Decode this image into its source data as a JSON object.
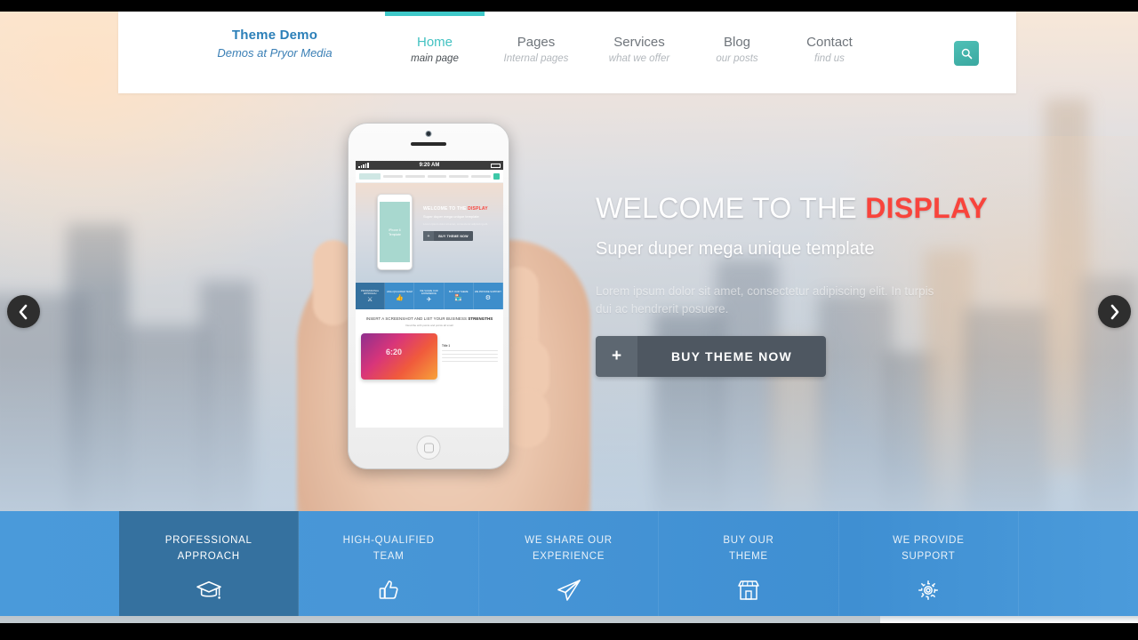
{
  "header": {
    "brand_title": "Theme Demo",
    "brand_subtitle": "Demos at Pryor Media",
    "search_icon": "search-icon",
    "nav": [
      {
        "label": "Home",
        "sub": "main page",
        "active": true
      },
      {
        "label": "Pages",
        "sub": "Internal pages",
        "active": false
      },
      {
        "label": "Services",
        "sub": "what we offer",
        "active": false
      },
      {
        "label": "Blog",
        "sub": "our posts",
        "active": false
      },
      {
        "label": "Contact",
        "sub": "find us",
        "active": false
      }
    ]
  },
  "hero": {
    "heading_main": "WELCOME TO THE ",
    "heading_accent": "DISPLAY",
    "subheading": "Super duper mega unique template",
    "paragraph": "Lorem ipsum dolor sit amet, consectetur adipiscing elit. In turpis dui ac hendrerit posuere.",
    "cta_plus": "+",
    "cta_label": "BUY THEME NOW",
    "prev_icon": "chevron-left-icon",
    "next_icon": "chevron-right-icon"
  },
  "phone_mockup": {
    "status_time": "9:20 AM",
    "inner_heading_main": "WELCOME TO THE ",
    "inner_heading_accent": "DISPLAY",
    "inner_subheading": "Super duper mega unique template",
    "inner_paragraph": "Lorem ipsum dolor sit amet, consectetur adipiscing elit.",
    "inner_cta_plus": "+",
    "inner_cta_label": "BUY THEME NOW",
    "inner_section_heading": "INSERT A SCREENSHOT AND LIST YOUR BUSINESS ",
    "inner_section_heading_bold": "STRENGTHS",
    "inner_section_sub": "Describe with points and points all small",
    "inner_caption_title": "Title 1",
    "inner_features": [
      {
        "label": "PROFESSIONAL APPROACH",
        "icon": "graduation-cap-icon"
      },
      {
        "label": "HIGH-QUALIFIED TEAM",
        "icon": "thumbs-up-icon"
      },
      {
        "label": "WE SHARE OUR EXPERIENCE",
        "icon": "paper-plane-icon"
      },
      {
        "label": "BUY OUR THEME",
        "icon": "store-icon"
      },
      {
        "label": "WE PROVIDE SUPPORT",
        "icon": "gear-icon"
      }
    ]
  },
  "features": [
    {
      "line1": "PROFESSIONAL",
      "line2": "APPROACH",
      "icon": "graduation-cap-icon",
      "active": true
    },
    {
      "line1": "HIGH-QUALIFIED",
      "line2": "TEAM",
      "icon": "thumbs-up-icon",
      "active": false
    },
    {
      "line1": "WE SHARE OUR",
      "line2": "EXPERIENCE",
      "icon": "paper-plane-icon",
      "active": false
    },
    {
      "line1": "BUY OUR",
      "line2": "THEME",
      "icon": "store-icon",
      "active": false
    },
    {
      "line1": "WE PROVIDE",
      "line2": "SUPPORT",
      "icon": "gear-icon",
      "active": false
    }
  ],
  "colors": {
    "teal_accent": "#3ec8c8",
    "red_accent": "#f8443c",
    "blue_bar": "#4795d6",
    "blue_bar_active": "#35719f",
    "brand_blue": "#2b7fb8",
    "cta_gray": "#4e5761"
  }
}
